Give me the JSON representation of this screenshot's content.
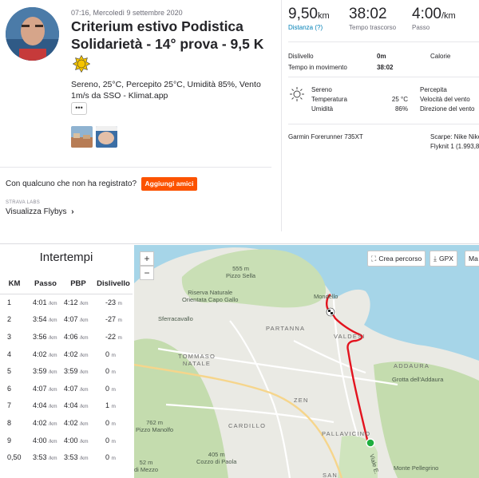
{
  "activity": {
    "datetime": "07:16, Mercoledì 9 settembre 2020",
    "title": "Criterium estivo Podistica Solidarietà - 14° prova - 9,5 K",
    "weather_description": "Sereno, 25°C, Percepito 25°C, Umidità 85%, Vento 1m/s da SSO - Klimat.app",
    "more_label": "•••"
  },
  "social": {
    "question": "Con qualcuno che non ha registrato?",
    "add_friends_label": "Aggiungi amici",
    "labs_label": "STRAVA LABS",
    "flyby_label": "Visualizza Flybys",
    "flyby_chevron": "›"
  },
  "stats": {
    "distance": {
      "value": "9,50",
      "unit": "km",
      "label": "Distanza (?)"
    },
    "moving_time": {
      "value": "38:02",
      "label": "Tempo trascorso"
    },
    "pace": {
      "value": "4:00",
      "unit": "/km",
      "label": "Passo"
    }
  },
  "details": {
    "elevation_label": "Dislivello",
    "elevation_value": "0m",
    "calories_label": "Calorie",
    "moving_label": "Tempo in movimento",
    "moving_value": "38:02"
  },
  "weather": {
    "condition": "Sereno",
    "temp_label": "Temperatura",
    "temp_value": "25 °C",
    "humidity_label": "Umidità",
    "humidity_value": "86%",
    "feels_label": "Percepita",
    "wind_speed_label": "Velocità del vento",
    "wind_dir_label": "Direzione del vento"
  },
  "gear": {
    "device": "Garmin Forerunner 735XT",
    "shoes_line1": "Scarpe: Nike Nike",
    "shoes_line2": "Flyknit 1 (1.993,8"
  },
  "splits": {
    "title": "Intertempi",
    "headers": [
      "KM",
      "Passo",
      "PBP",
      "Dislivello"
    ],
    "unit_pace": "/km",
    "unit_elev": "m",
    "rows": [
      {
        "km": "1",
        "pace": "4:01",
        "gap": "4:12",
        "elev": "-23"
      },
      {
        "km": "2",
        "pace": "3:54",
        "gap": "4:07",
        "elev": "-27"
      },
      {
        "km": "3",
        "pace": "3:56",
        "gap": "4:06",
        "elev": "-22"
      },
      {
        "km": "4",
        "pace": "4:02",
        "gap": "4:02",
        "elev": "0"
      },
      {
        "km": "5",
        "pace": "3:59",
        "gap": "3:59",
        "elev": "0"
      },
      {
        "km": "6",
        "pace": "4:07",
        "gap": "4:07",
        "elev": "0"
      },
      {
        "km": "7",
        "pace": "4:04",
        "gap": "4:04",
        "elev": "1"
      },
      {
        "km": "8",
        "pace": "4:02",
        "gap": "4:02",
        "elev": "0"
      },
      {
        "km": "9",
        "pace": "4:00",
        "gap": "4:00",
        "elev": "0"
      },
      {
        "km": "0,50",
        "pace": "3:53",
        "gap": "3:53",
        "elev": "0"
      }
    ]
  },
  "map": {
    "zoom_in": "+",
    "zoom_out": "−",
    "create_route_label": "Crea percorso",
    "gpx_label": "GPX",
    "more_label": "Ma",
    "labels": {
      "pizzo_sella": "555 m\nPizzo Sella",
      "riserva": "Riserva Naturale\nOrientata Capo Gallo",
      "mondello": "Mondello",
      "sferracavallo": "Sferracavallo",
      "partanna": "PARTANNA",
      "valdesi": "VALDESI",
      "tommaso_natale": "TOMMASO\nNATALE",
      "addaura": "ADDAURA",
      "grotta": "Grotta dell'Addaura",
      "zen": "ZEN",
      "pizzo_manolfo": "762 m\nPizzo Manolfo",
      "cardillo": "CARDILLO",
      "pallavicino": "PALLAVICINO",
      "cozzo": "405 m\nCozzo di Paola",
      "mezzo": "52 m\ndi Mezzo",
      "pellegrino": "Monte Pellegrino",
      "viale": "Viale E.",
      "san": "SAN"
    },
    "route_color": "#e3131e",
    "start_color": "#1fae3f",
    "brand_color": "#fc5200"
  }
}
